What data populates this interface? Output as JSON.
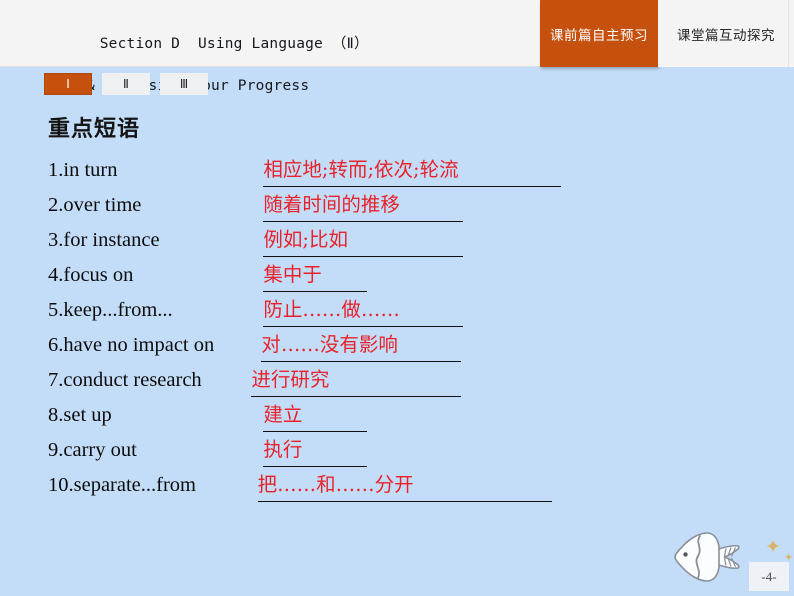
{
  "header": {
    "title_line1": "Section D  Using Language （Ⅱ）",
    "title_line2": "& Assessing Your Progress",
    "tabs": [
      {
        "label": "课前篇自主预习",
        "active": true
      },
      {
        "label": "课堂篇互动探究",
        "active": false
      }
    ]
  },
  "roman_tabs": [
    {
      "label": "Ⅰ",
      "active": true
    },
    {
      "label": "Ⅱ",
      "active": false
    },
    {
      "label": "Ⅲ",
      "active": false
    }
  ],
  "section": {
    "heading": "重点短语"
  },
  "phrases": [
    {
      "num": "1.",
      "en": "in turn",
      "answer": "相应地;转而;依次;轮流",
      "en_width": 200,
      "line_width": 298
    },
    {
      "num": "2.",
      "en": "over time",
      "answer": "随着时间的推移",
      "en_width": 200,
      "line_width": 200
    },
    {
      "num": "3.",
      "en": "for instance",
      "answer": "例如;比如",
      "en_width": 200,
      "line_width": 200
    },
    {
      "num": "4.",
      "en": "focus on",
      "answer": "集中于",
      "en_width": 200,
      "line_width": 104
    },
    {
      "num": "5.",
      "en": "keep...from...",
      "answer": "防止……做……",
      "en_width": 200,
      "line_width": 200
    },
    {
      "num": "6.",
      "en": "have no impact on",
      "answer": "对……没有影响",
      "en_width": 198,
      "line_width": 200
    },
    {
      "num": "7.",
      "en": "conduct research",
      "answer": "进行研究",
      "en_width": 188,
      "line_width": 210
    },
    {
      "num": "8.",
      "en": "set up",
      "answer": "建立",
      "en_width": 200,
      "line_width": 104
    },
    {
      "num": "9.",
      "en": "carry out",
      "answer": "执行",
      "en_width": 200,
      "line_width": 104
    },
    {
      "num": "10.",
      "en": "separate...from",
      "answer": "把……和……分开",
      "en_width": 184,
      "line_width": 294
    }
  ],
  "footer": {
    "page_number": "-4-",
    "fish_icon": "fish-icon",
    "star_icon": "star-icon"
  },
  "colors": {
    "accent_orange": "#c6500e",
    "answer_red": "#e8222a",
    "page_background": "#c3ddf9",
    "header_background": "#f4f4f4"
  }
}
